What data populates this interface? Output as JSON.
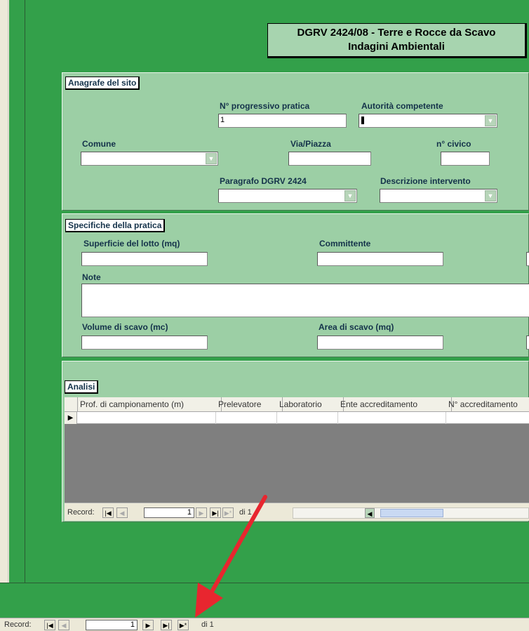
{
  "title": {
    "line1": "DGRV 2424/08 - Terre e Rocce da Scavo",
    "line2": "Indagini Ambientali"
  },
  "anagrafe": {
    "section_label": "Anagrafe del sito",
    "progressivo_label": "N° progressivo pratica",
    "progressivo_value": "1",
    "autorita_label": "Autorità competente",
    "comune_label": "Comune",
    "via_label": "Via/Piazza",
    "civico_label": "n° civico",
    "paragrafo_label": "Paragrafo DGRV 2424",
    "descrizione_label": "Descrizione intervento"
  },
  "specifiche": {
    "section_label": "Specifiche della pratica",
    "superficie_label": "Superficie del lotto (mq)",
    "committente_label": "Committente",
    "note_label": "Note",
    "volume_label": "Volume di scavo (mc)",
    "area_label": "Area di scavo (mq)"
  },
  "analisi": {
    "section_label": "Analisi",
    "columns": [
      "Prof. di campionamento (m)",
      "Prelevatore",
      "Laboratorio",
      "Ente accreditamento",
      "N° accreditamento"
    ]
  },
  "subform_nav": {
    "label": "Record:",
    "current": "1",
    "total": "di 1"
  },
  "main_nav": {
    "label": "Record:",
    "current": "1",
    "total": "di 1"
  },
  "colors": {
    "form_green": "#33a04a",
    "section_green": "#9ccfa5",
    "arrow_red": "#e8262f"
  }
}
